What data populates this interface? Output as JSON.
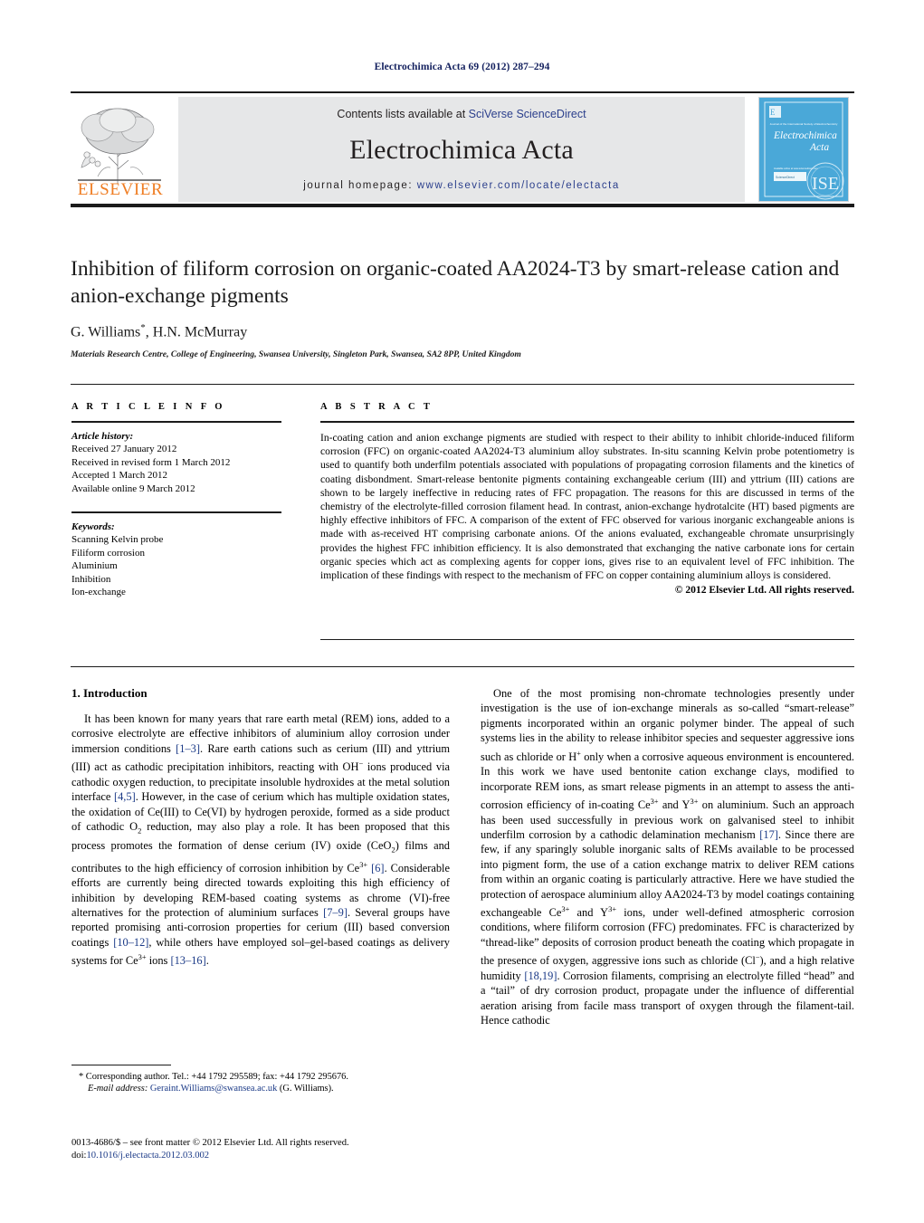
{
  "journal_ref": "Electrochimica Acta 69 (2012) 287–294",
  "masthead": {
    "contents_prefix": "Contents lists available at ",
    "contents_link": "SciVerse ScienceDirect",
    "journal_name": "Electrochimica Acta",
    "homepage_prefix": "journal homepage: ",
    "homepage_url": "www.elsevier.com/locate/electacta",
    "publisher": "ELSEVIER",
    "publisher_color": "#ef7d23",
    "link_color": "#2b3f8c",
    "cover": {
      "title": "Electrochimica Acta",
      "top_caption": "Journal of the International Society of Electrochemistry",
      "badge": "ISE",
      "bg_color": "#4aa8d8"
    }
  },
  "article": {
    "title": "Inhibition of filiform corrosion on organic-coated AA2024-T3 by smart-release cation and anion-exchange pigments",
    "authors": "G. Williams",
    "authors_rest": ", H.N. McMurray",
    "corresponding_mark": "*",
    "affiliation": "Materials Research Centre, College of Engineering, Swansea University, Singleton Park, Swansea, SA2 8PP, United Kingdom"
  },
  "info": {
    "heading": "A R T I C L E    I N F O",
    "history_label": "Article history:",
    "history": [
      "Received 27 January 2012",
      "Received in revised form 1 March 2012",
      "Accepted 1 March 2012",
      "Available online 9 March 2012"
    ],
    "keywords_label": "Keywords:",
    "keywords": [
      "Scanning Kelvin probe",
      "Filiform corrosion",
      "Aluminium",
      "Inhibition",
      "Ion-exchange"
    ]
  },
  "abstract": {
    "heading": "A B S T R A C T",
    "text": "In-coating cation and anion exchange pigments are studied with respect to their ability to inhibit chloride-induced filiform corrosion (FFC) on organic-coated AA2024-T3 aluminium alloy substrates. In-situ scanning Kelvin probe potentiometry is used to quantify both underfilm potentials associated with populations of propagating corrosion filaments and the kinetics of coating disbondment. Smart-release bentonite pigments containing exchangeable cerium (III) and yttrium (III) cations are shown to be largely ineffective in reducing rates of FFC propagation. The reasons for this are discussed in terms of the chemistry of the electrolyte-filled corrosion filament head. In contrast, anion-exchange hydrotalcite (HT) based pigments are highly effective inhibitors of FFC. A comparison of the extent of FFC observed for various inorganic exchangeable anions is made with as-received HT comprising carbonate anions. Of the anions evaluated, exchangeable chromate unsurprisingly provides the highest FFC inhibition efficiency. It is also demonstrated that exchanging the native carbonate ions for certain organic species which act as complexing agents for copper ions, gives rise to an equivalent level of FFC inhibition. The implication of these findings with respect to the mechanism of FFC on copper containing aluminium alloys is considered.",
    "copyright": "© 2012 Elsevier Ltd. All rights reserved."
  },
  "body": {
    "section_heading": "1. Introduction",
    "left_paragraph_1_html": "It has been known for many years that rare earth metal (REM) ions, added to a corrosive electrolyte are effective inhibitors of aluminium alloy corrosion under immersion conditions <span class=\"ref\">[1–3]</span>. Rare earth cations such as cerium (III) and yttrium (III) act as cathodic precipitation inhibitors, reacting with OH<sup class=\"sm\">−</sup> ions produced via cathodic oxygen reduction, to precipitate insoluble hydroxides at the metal solution interface <span class=\"ref\">[4,5]</span>. However, in the case of cerium which has multiple oxidation states, the oxidation of Ce(III) to Ce(VI) by hydrogen peroxide, formed as a side product of cathodic O<sub class=\"sm\">2</sub> reduction, may also play a role. It has been proposed that this process promotes the formation of dense cerium (IV) oxide (CeO<sub class=\"sm\">2</sub>) films and contributes to the high efficiency of corrosion inhibition by Ce<sup class=\"sm\">3+</sup> <span class=\"ref\">[6]</span>. Considerable efforts are currently being directed towards exploiting this high efficiency of inhibition by developing REM-based coating systems as chrome (VI)-free alternatives for the protection of aluminium surfaces <span class=\"ref\">[7–9]</span>. Several groups have reported promising anti-corrosion properties for cerium (III) based conversion coatings <span class=\"ref\">[10–12]</span>, while others have employed sol–gel-based coatings as delivery systems for Ce<sup class=\"sm\">3+</sup> ions <span class=\"ref\">[13–16]</span>.",
    "right_paragraph_1_html": "One of the most promising non-chromate technologies presently under investigation is the use of ion-exchange minerals as so-called “smart-release” pigments incorporated within an organic polymer binder. The appeal of such systems lies in the ability to release inhibitor species and sequester aggressive ions such as chloride or H<sup class=\"sm\">+</sup> only when a corrosive aqueous environment is encountered. In this work we have used bentonite cation exchange clays, modified to incorporate REM ions, as smart release pigments in an attempt to assess the anti-corrosion efficiency of in-coating Ce<sup class=\"sm\">3+</sup> and Y<sup class=\"sm\">3+</sup> on aluminium. Such an approach has been used successfully in previous work on galvanised steel to inhibit underfilm corrosion by a cathodic delamination mechanism <span class=\"ref\">[17]</span>. Since there are few, if any sparingly soluble inorganic salts of REMs available to be processed into pigment form, the use of a cation exchange matrix to deliver REM cations from within an organic coating is particularly attractive. Here we have studied the protection of aerospace aluminium alloy AA2024-T3 by model coatings containing exchangeable Ce<sup class=\"sm\">3+</sup> and Y<sup class=\"sm\">3+</sup> ions, under well-defined atmospheric corrosion conditions, where filiform corrosion (FFC) predominates. FFC is characterized by “thread-like” deposits of corrosion product beneath the coating which propagate in the presence of oxygen, aggressive ions such as chloride (Cl<sup class=\"sm\">−</sup>), and a high relative humidity <span class=\"ref\">[18,19]</span>. Corrosion filaments, comprising an electrolyte filled “head” and a “tail” of dry corrosion product, propagate under the influence of differential aeration arising from facile mass transport of oxygen through the filament-tail. Hence cathodic"
  },
  "footnote": {
    "corresponding_html": "<span class=\"star\">*</span> Corresponding author. Tel.: +44 1792 295589; fax: +44 1792 295676.",
    "email_label": "E-mail address:",
    "email": "Geraint.Williams@swansea.ac.uk",
    "email_suffix": " (G. Williams).",
    "issn_line": "0013-4686/$ – see front matter © 2012 Elsevier Ltd. All rights reserved.",
    "doi_label": "doi:",
    "doi": "10.1016/j.electacta.2012.03.002"
  }
}
